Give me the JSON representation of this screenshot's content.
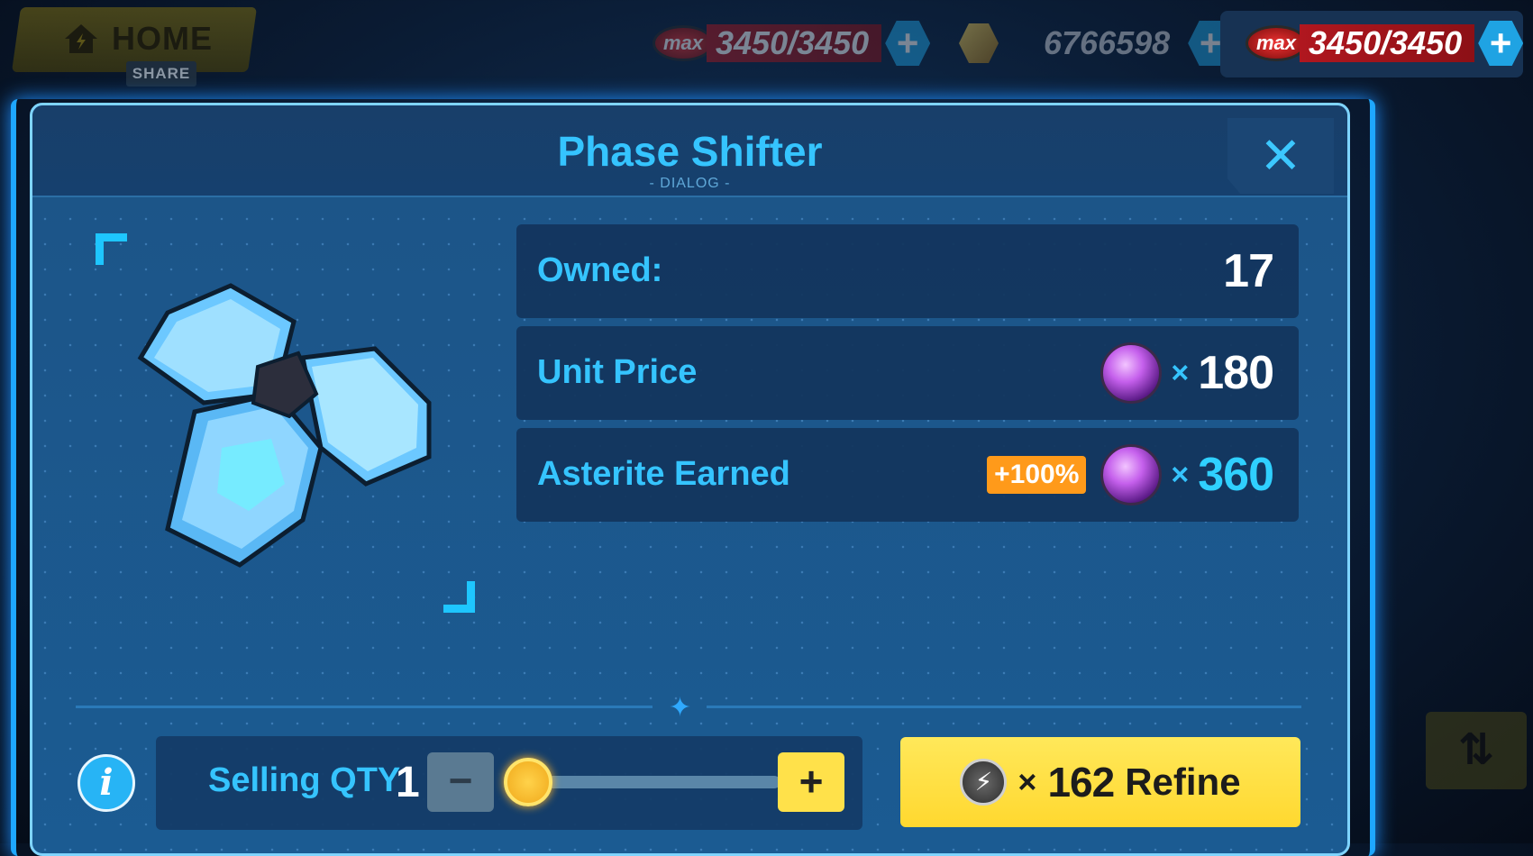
{
  "topbar": {
    "home_label": "HOME",
    "share_label": "SHARE",
    "resources": [
      {
        "badge": "max",
        "value": "3450/3450",
        "plus": "+"
      },
      {
        "value": "6766598",
        "plus": "+"
      },
      {
        "badge": "max",
        "value": "3450/3450",
        "plus": "+"
      }
    ]
  },
  "dialog": {
    "title": "Phase Shifter",
    "subtitle": "- DIALOG -",
    "close": "✕",
    "owned": {
      "label": "Owned:",
      "value": "17"
    },
    "unit_price": {
      "label": "Unit Price",
      "times": "×",
      "value": "180"
    },
    "asterite": {
      "label": "Asterite Earned",
      "bonus": "+100%",
      "times": "×",
      "value": "360"
    },
    "divider_star": "✦",
    "info": "i",
    "qty": {
      "label": "Selling QTY",
      "value": "1",
      "minus": "−",
      "plus": "+",
      "slider_fraction": 0
    },
    "refine": {
      "times": "×",
      "cost": "162",
      "label": "Refine",
      "icon": "⚡"
    }
  },
  "side_button": "⇅",
  "colors": {
    "accent": "#35c4ff",
    "button_yellow": "#ffe14a",
    "bonus_orange": "#ff9a1a"
  }
}
